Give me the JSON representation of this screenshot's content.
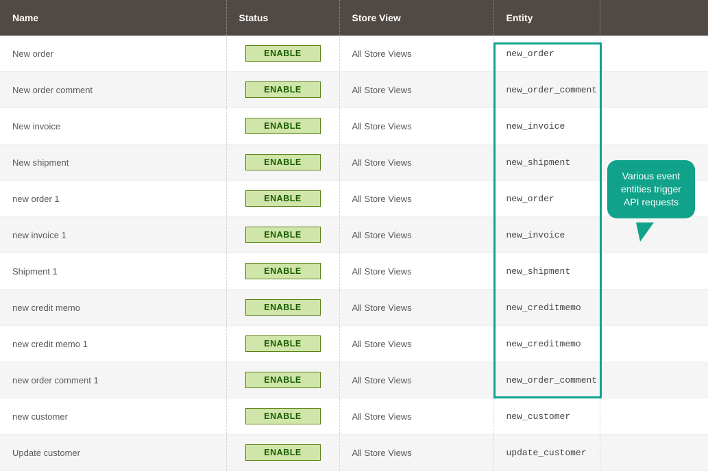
{
  "colors": {
    "accent": "#10a28a",
    "header_bg": "#514943",
    "badge_bg": "#d0e5a9",
    "badge_border": "#5b8116",
    "badge_text": "#185b00"
  },
  "table": {
    "headers": {
      "name": "Name",
      "status": "Status",
      "store": "Store View",
      "entity": "Entity"
    },
    "status_label": "ENABLE",
    "store_view_label": "All Store Views",
    "rows": [
      {
        "name": "New order",
        "entity": "new_order"
      },
      {
        "name": "New order comment",
        "entity": "new_order_comment"
      },
      {
        "name": "New invoice",
        "entity": "new_invoice"
      },
      {
        "name": "New shipment",
        "entity": "new_shipment"
      },
      {
        "name": "new order 1",
        "entity": "new_order"
      },
      {
        "name": "new invoice 1",
        "entity": "new_invoice"
      },
      {
        "name": "Shipment 1",
        "entity": "new_shipment"
      },
      {
        "name": "new credit memo",
        "entity": "new_creditmemo"
      },
      {
        "name": "new credit memo 1",
        "entity": "new_creditmemo"
      },
      {
        "name": "new order comment 1",
        "entity": "new_order_comment"
      },
      {
        "name": "new customer",
        "entity": "new_customer"
      },
      {
        "name": "Update customer",
        "entity": "update_customer"
      }
    ]
  },
  "callout": {
    "text": "Various event entities trigger API requests"
  }
}
